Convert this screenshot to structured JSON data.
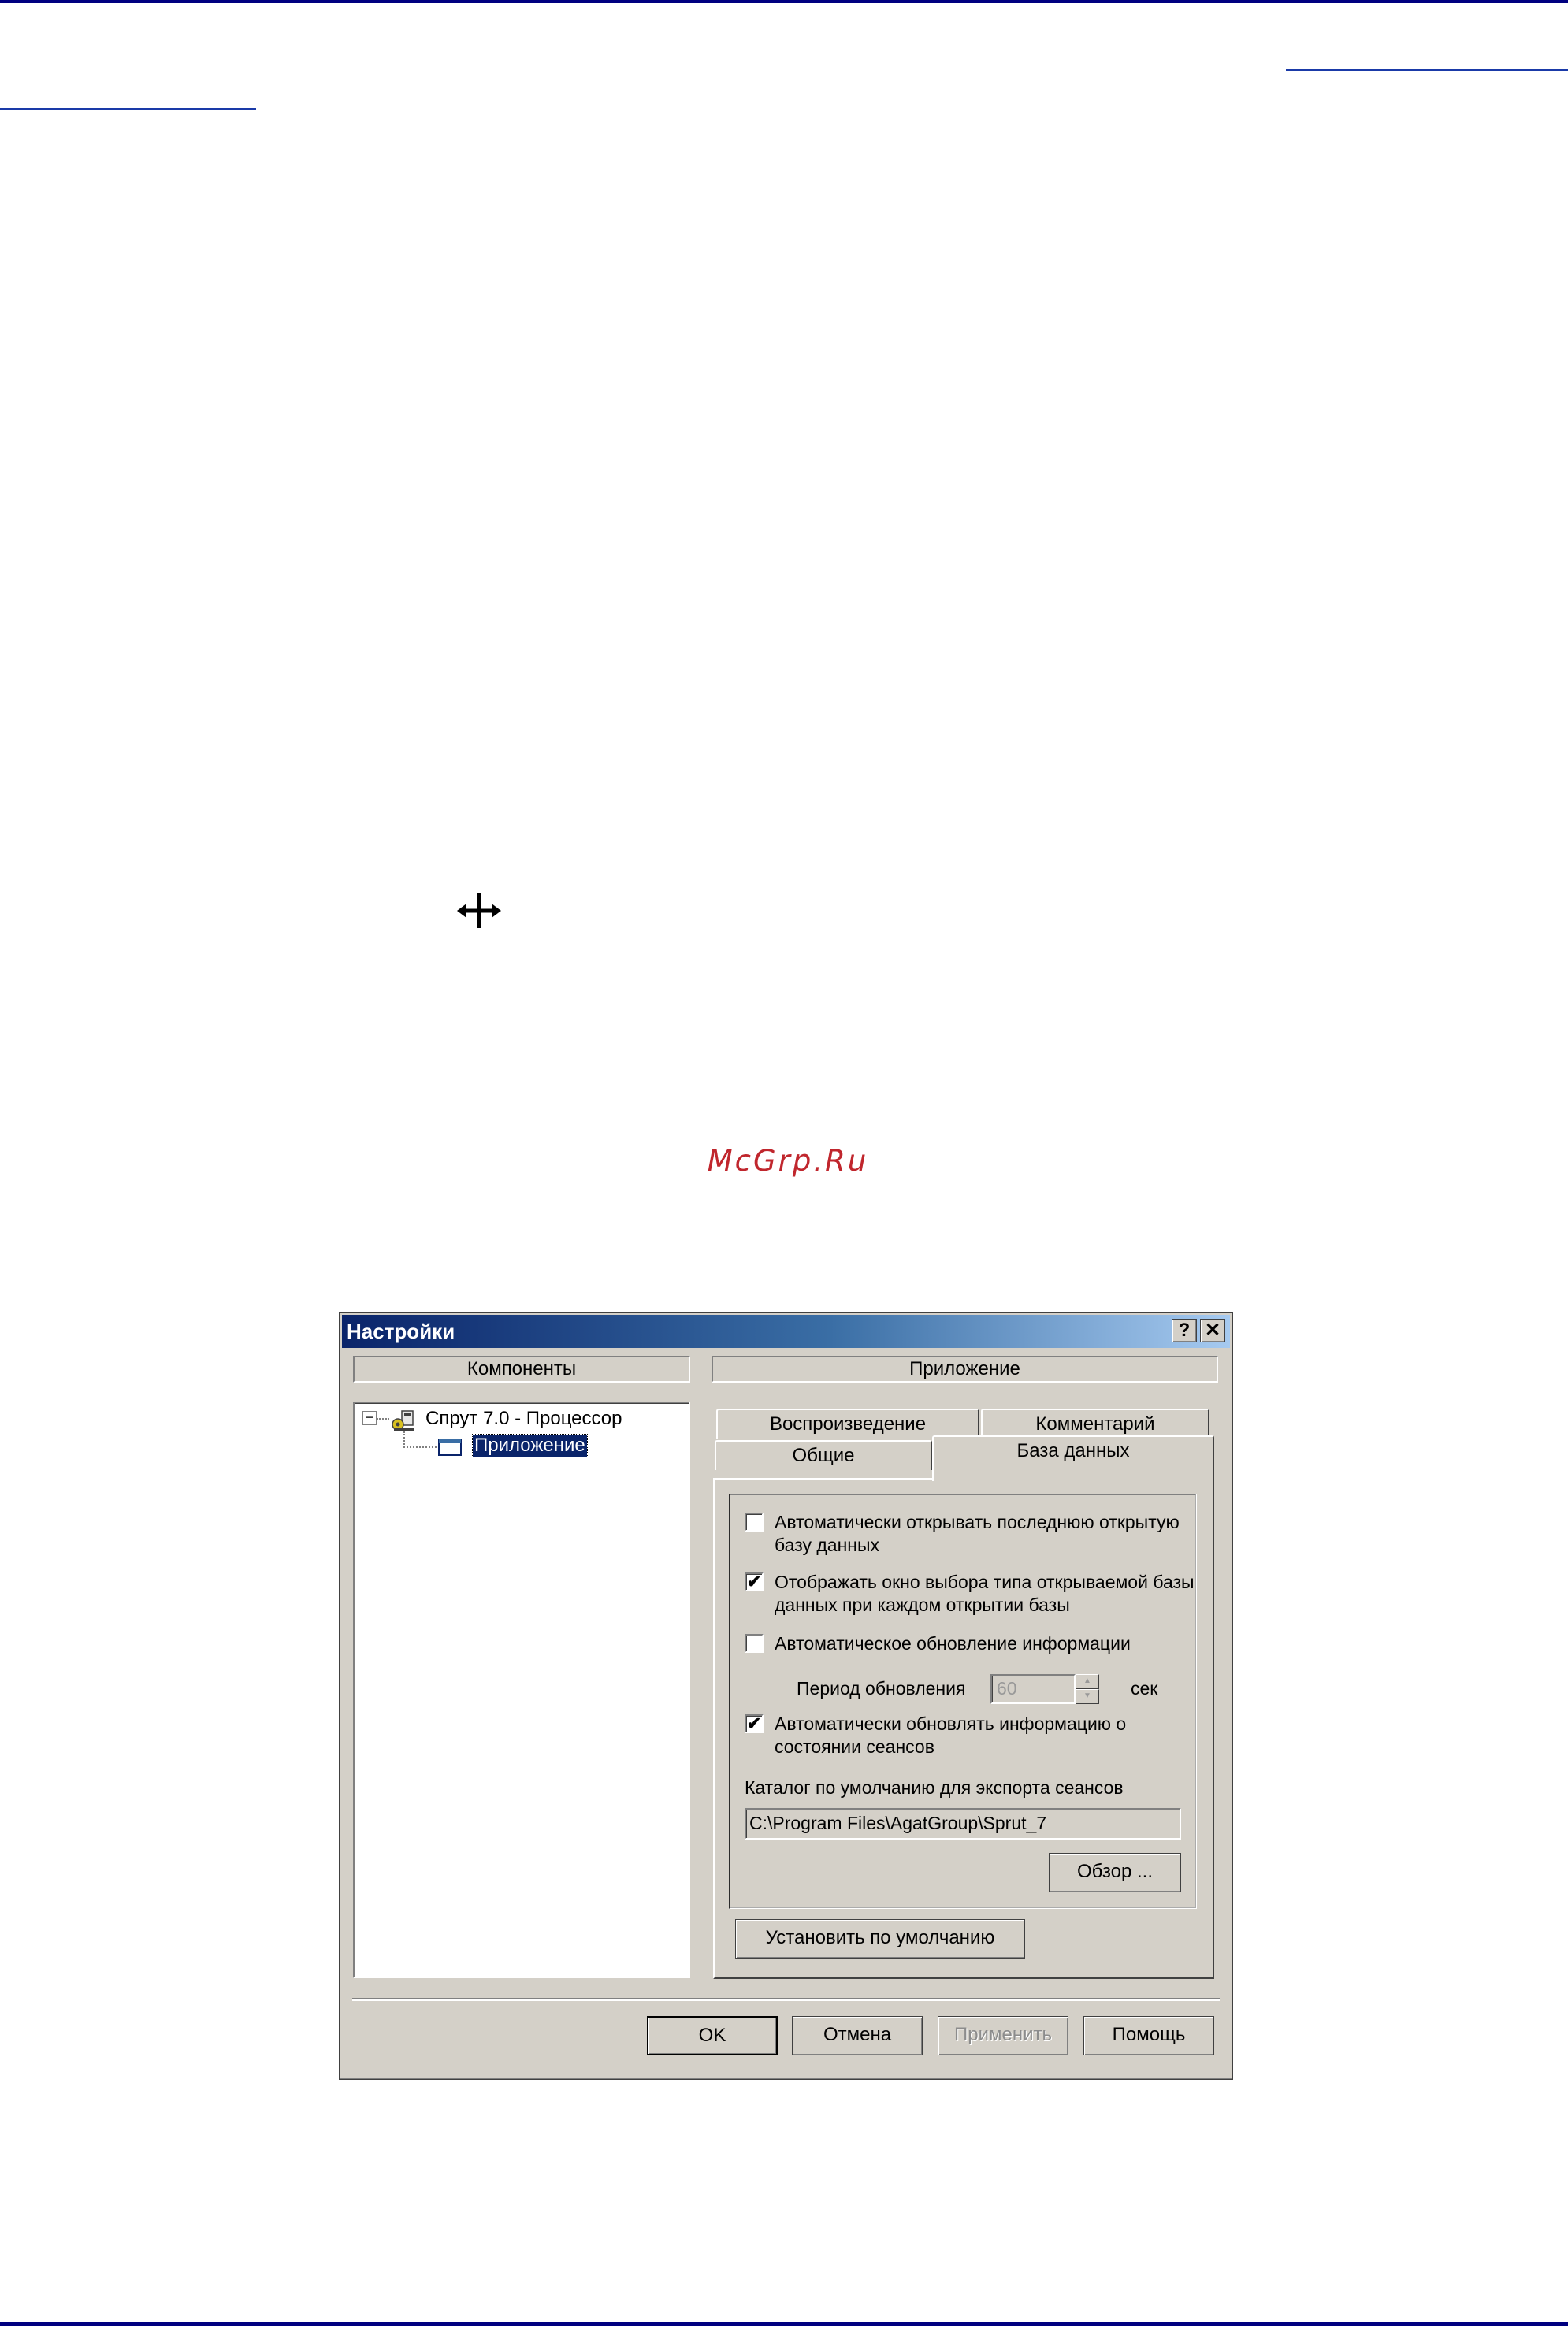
{
  "page": {
    "watermark": "McGrp.Ru",
    "rule_color": "#000080",
    "move_icon": "move-cursor-icon"
  },
  "dialog": {
    "title": "Настройки",
    "help_label": "?",
    "close_label": "✕",
    "components_header": "Компоненты",
    "app_header": "Приложение",
    "tree": {
      "root_expander": "−",
      "root_label": "Спрут 7.0 - Процессор",
      "root_icon": "processor-icon",
      "child_label": "Приложение",
      "child_icon": "window-icon"
    },
    "tabs": {
      "playback": "Воспроизведение",
      "comment": "Комментарий",
      "general": "Общие",
      "database": "База данных",
      "active": "База данных"
    },
    "options": {
      "auto_open_last": {
        "label": "Автоматически открывать последнюю открытую базу данных",
        "checked": false
      },
      "show_type_dialog": {
        "label": "Отображать окно выбора типа открываемой базы данных при каждом открытии базы",
        "checked": true
      },
      "auto_refresh": {
        "label": "Автоматическое обновление информации",
        "checked": false
      },
      "refresh_period_label": "Период обновления",
      "refresh_period_value": "60",
      "refresh_period_unit": "сек",
      "auto_update_sessions": {
        "label": "Автоматически обновлять информацию о состоянии сеансов",
        "checked": true
      },
      "export_dir_label": "Каталог по умолчанию для экспорта сеансов",
      "export_dir_value": "C:\\Program Files\\AgatGroup\\Sprut_7",
      "browse_label": "Обзор ...",
      "defaults_label": "Установить по умолчанию",
      "check_mark": "✔"
    },
    "buttons": {
      "ok": "OK",
      "cancel": "Отмена",
      "apply": "Применить",
      "help": "Помощь"
    }
  }
}
